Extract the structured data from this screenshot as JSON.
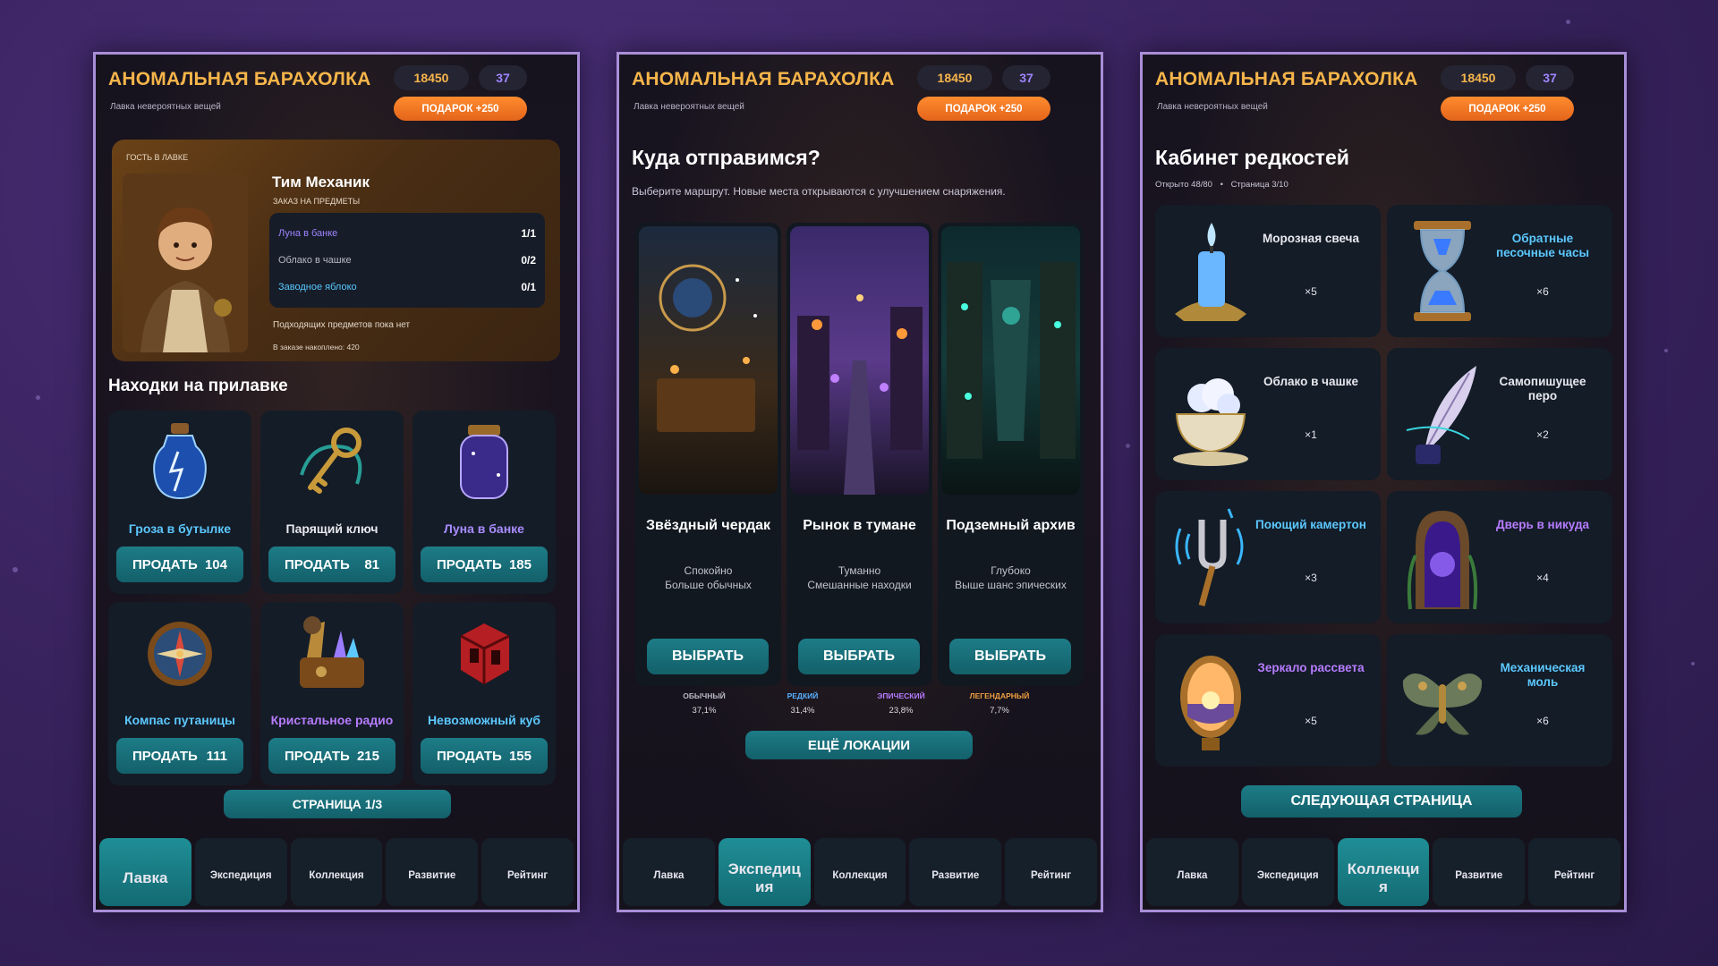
{
  "app": {
    "title": "АНОМАЛЬНАЯ БАРАХОЛКА",
    "subtitle": "Лавка невероятных вещей",
    "coins": "18450",
    "gems": "37",
    "gift_label": "ПОДАРОК +250"
  },
  "nav": {
    "shop": "Лавка",
    "expedition": "Экспедиция",
    "collection": "Коллекция",
    "progress": "Развитие",
    "rating": "Рейтинг",
    "expedition_active": "Экспедиц ия",
    "collection_active": "Коллекци я"
  },
  "shop": {
    "guest_tag": "ГОСТЬ В ЛАВКЕ",
    "guest_name": "Тим Механик",
    "order_label": "ЗАКАЗ НА ПРЕДМЕТЫ",
    "order_items": [
      {
        "name": "Луна в банке",
        "qty": "1/1",
        "color": "#9f84ff"
      },
      {
        "name": "Облако в чашке",
        "qty": "0/2",
        "color": "#b9b9c6"
      },
      {
        "name": "Заводное яблоко",
        "qty": "0/1",
        "color": "#58c9ff"
      }
    ],
    "note": "Подходящих предметов пока нет",
    "accumulated": "В заказе накоплено: 420",
    "section_title": "Находки на прилавке",
    "sell_label": "ПРОДАТЬ",
    "items": [
      {
        "name": "Гроза в бутылке",
        "price": "104",
        "color": "#5cc8ff",
        "icon": "bottle-lightning-icon"
      },
      {
        "name": "Парящий ключ",
        "price": "81",
        "color": "#e8e8ee",
        "icon": "floating-key-icon"
      },
      {
        "name": "Луна в банке",
        "price": "185",
        "color": "#a88cff",
        "icon": "moon-jar-icon"
      },
      {
        "name": "Компас путаницы",
        "price": "111",
        "color": "#5cc8ff",
        "icon": "compass-icon"
      },
      {
        "name": "Кристальное радио",
        "price": "215",
        "color": "#b77cff",
        "icon": "crystal-radio-icon"
      },
      {
        "name": "Невозможный куб",
        "price": "155",
        "color": "#5cc8ff",
        "icon": "impossible-cube-icon"
      }
    ],
    "page_label": "СТРАНИЦА 1/3"
  },
  "expedition": {
    "title": "Куда отправимся?",
    "hint": "Выберите маршрут. Новые места открываются с улучшением снаряжения.",
    "choose_label": "ВЫБРАТЬ",
    "locations": [
      {
        "name": "Звёздный чердак",
        "desc1": "Спокойно",
        "desc2": "Больше обычных",
        "icon": "starry-attic-image"
      },
      {
        "name": "Рынок в тумане",
        "desc1": "Туманно",
        "desc2": "Смешанные находки",
        "icon": "foggy-market-image"
      },
      {
        "name": "Подземный архив",
        "desc1": "Глубоко",
        "desc2": "Выше шанс эпических",
        "icon": "underground-archive-image"
      }
    ],
    "odds": [
      {
        "name": "ОБЫЧНЫЙ",
        "value": "37,1%",
        "color": "#b9b9c6"
      },
      {
        "name": "РЕДКИЙ",
        "value": "31,4%",
        "color": "#58b0ff"
      },
      {
        "name": "ЭПИЧЕСКИЙ",
        "value": "23,8%",
        "color": "#b77cff"
      },
      {
        "name": "ЛЕГЕНДАРНЫЙ",
        "value": "7,7%",
        "color": "#f0a040"
      }
    ],
    "more_label": "ЕЩЁ ЛОКАЦИИ"
  },
  "collection": {
    "title": "Кабинет редкостей",
    "opened": "Открыто 48/80",
    "sep": "•",
    "page": "Страница 3/10",
    "items": [
      {
        "name": "Морозная свеча",
        "count": "×5",
        "color": "#e8e8ee",
        "icon": "frost-candle-icon"
      },
      {
        "name": "Обратные песочные часы",
        "count": "×6",
        "color": "#5cc8ff",
        "icon": "hourglass-icon"
      },
      {
        "name": "Облако в чашке",
        "count": "×1",
        "color": "#e8e8ee",
        "icon": "cloud-cup-icon"
      },
      {
        "name": "Самопишущее перо",
        "count": "×2",
        "color": "#e8e8ee",
        "icon": "quill-icon"
      },
      {
        "name": "Поющий камертон",
        "count": "×3",
        "color": "#5cc8ff",
        "icon": "tuning-fork-icon"
      },
      {
        "name": "Дверь в никуда",
        "count": "×4",
        "color": "#b77cff",
        "icon": "door-icon"
      },
      {
        "name": "Зеркало рассвета",
        "count": "×5",
        "color": "#b77cff",
        "icon": "dawn-mirror-icon"
      },
      {
        "name": "Механическая моль",
        "count": "×6",
        "color": "#5cc8ff",
        "icon": "mechanical-moth-icon"
      }
    ],
    "next_label": "СЛЕДУЮЩАЯ СТРАНИЦА"
  }
}
